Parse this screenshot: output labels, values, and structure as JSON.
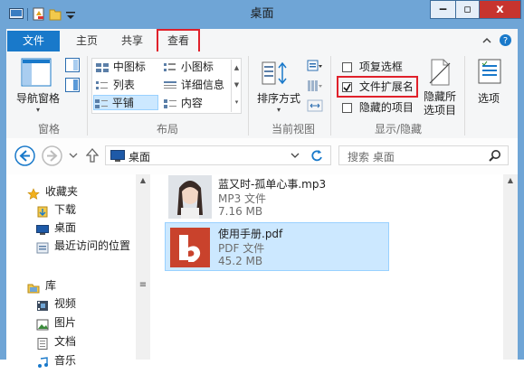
{
  "window": {
    "title": "桌面",
    "minimize": "‒",
    "maximize": "▫",
    "close": "x"
  },
  "tabs": [
    "文件",
    "主页",
    "共享",
    "查看"
  ],
  "ribbon": {
    "panes": {
      "nav_pane_label": "导航窗格",
      "group_label": "窗格"
    },
    "layout": {
      "items": [
        "中图标",
        "小图标",
        "列表",
        "详细信息",
        "平铺",
        "内容"
      ],
      "selected": "平铺",
      "group_label": "布局"
    },
    "current_view": {
      "sort_label": "排序方式",
      "group_label": "当前视图"
    },
    "show_hide": {
      "item_checkboxes": {
        "label": "项复选框",
        "checked": false
      },
      "file_extensions": {
        "label": "文件扩展名",
        "checked": true
      },
      "hidden_items": {
        "label": "隐藏的项目",
        "checked": false
      },
      "hide_selected_line1": "隐藏所",
      "hide_selected_line2": "选项目",
      "group_label": "显示/隐藏"
    },
    "options_label": "选项"
  },
  "address": {
    "path": "桌面",
    "search_placeholder": "搜索 桌面"
  },
  "nav_pane": {
    "favorites": {
      "label": "收藏夹",
      "items": [
        "下载",
        "桌面",
        "最近访问的位置"
      ]
    },
    "libraries": {
      "label": "库",
      "items": [
        "视频",
        "图片",
        "文档",
        "音乐"
      ]
    }
  },
  "files": [
    {
      "name": "蓝又时-孤单心事.mp3",
      "type": "MP3 文件",
      "size": "7.16 MB",
      "selected": false
    },
    {
      "name": "使用手册.pdf",
      "type": "PDF 文件",
      "size": "45.2 MB",
      "selected": true
    }
  ],
  "colors": {
    "accent": "#1979ca",
    "frame": "#6fa5d6",
    "highlight": "#e0212b",
    "selection": "#cce8ff",
    "close": "#c7342e"
  }
}
